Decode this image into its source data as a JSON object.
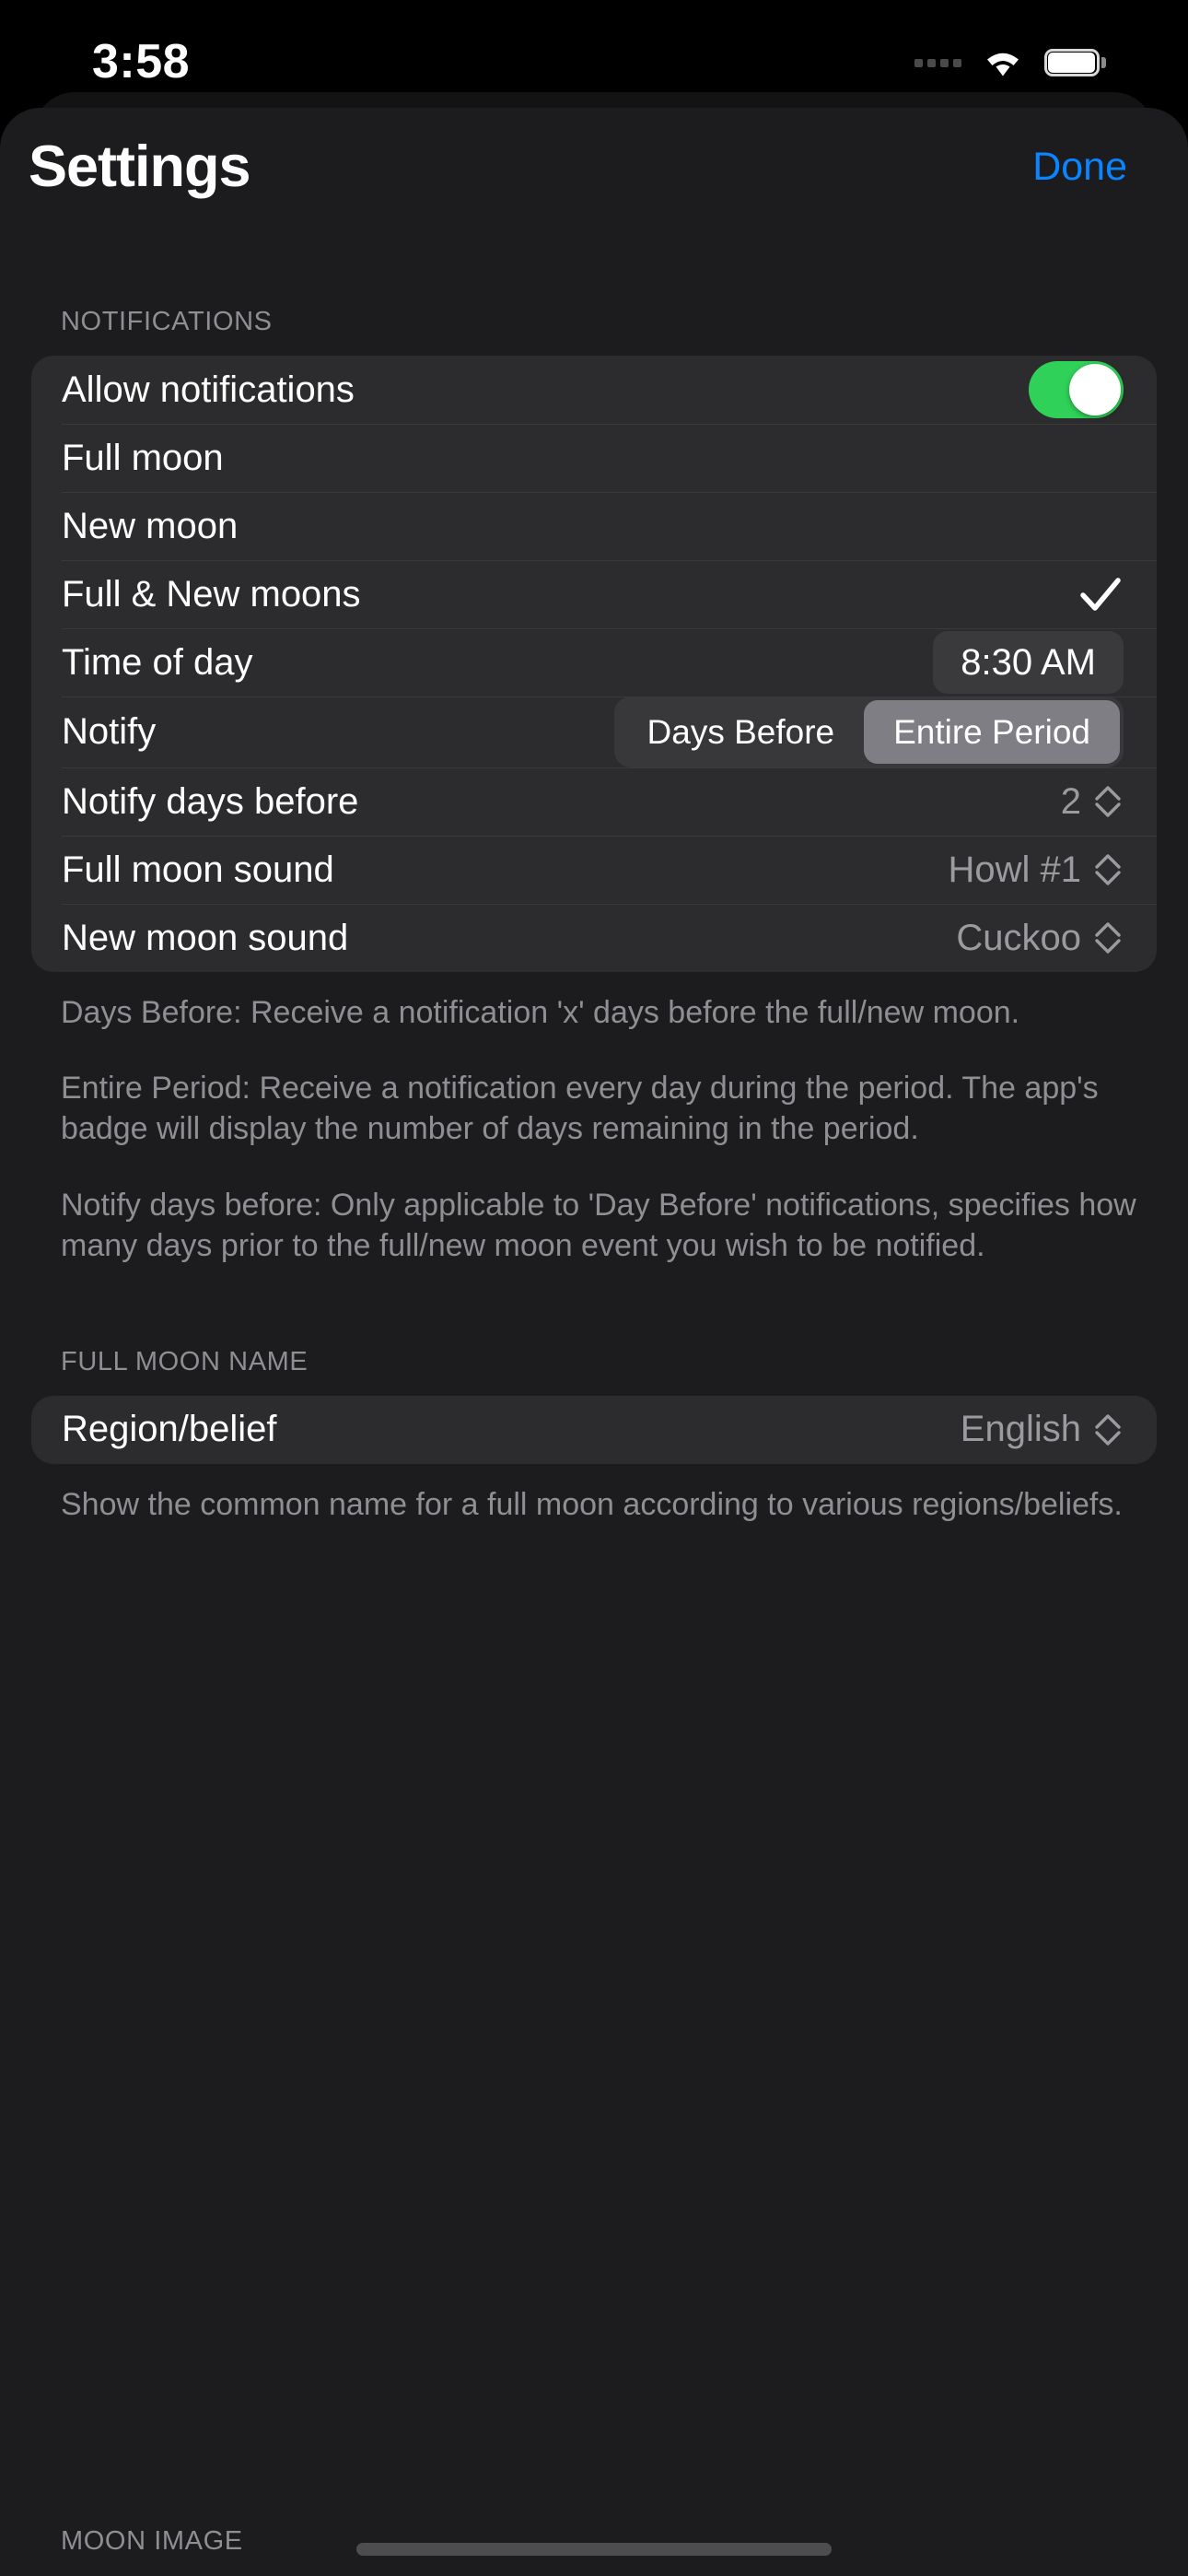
{
  "status_bar": {
    "time": "3:58",
    "signal_icon": "signal-dots-icon",
    "wifi_icon": "wifi-icon",
    "battery_icon": "battery-icon"
  },
  "nav": {
    "title": "Settings",
    "done_label": "Done",
    "done_color": "#0a84ff"
  },
  "sections": {
    "notifications": {
      "header": "NOTIFICATIONS",
      "rows": {
        "allow": {
          "label": "Allow notifications",
          "toggle_on": true,
          "toggle_color": "#30d158"
        },
        "full_moon": {
          "label": "Full moon",
          "checked": false
        },
        "new_moon": {
          "label": "New moon",
          "checked": false
        },
        "full_new_moons": {
          "label": "Full & New moons",
          "checked": true,
          "check_icon": "checkmark-icon"
        },
        "time_of_day": {
          "label": "Time of day",
          "value": "8:30 AM"
        },
        "notify": {
          "label": "Notify",
          "options": [
            "Days Before",
            "Entire Period"
          ],
          "selected": "Entire Period"
        },
        "notify_days_before": {
          "label": "Notify days before",
          "value": "2",
          "stepper_icon": "chevron-up-down-icon"
        },
        "full_moon_sound": {
          "label": "Full moon sound",
          "value": "Howl #1",
          "stepper_icon": "chevron-up-down-icon"
        },
        "new_moon_sound": {
          "label": "New moon sound",
          "value": "Cuckoo",
          "stepper_icon": "chevron-up-down-icon"
        }
      },
      "footnotes": [
        "Days Before: Receive a notification 'x' days before the full/new moon.",
        "Entire Period: Receive a notification every day during the period. The app's badge will display the number of days remaining in the period.",
        "Notify days before: Only applicable to 'Day Before' notifications, specifies how many days prior to the full/new moon event you wish to be notified."
      ]
    },
    "full_moon_name": {
      "header": "FULL MOON NAME",
      "row": {
        "label": "Region/belief",
        "value": "English",
        "stepper_icon": "chevron-up-down-icon"
      },
      "footnote": "Show the common name for a full moon according to various regions/beliefs."
    },
    "moon_image": {
      "header": "MOON IMAGE"
    }
  }
}
